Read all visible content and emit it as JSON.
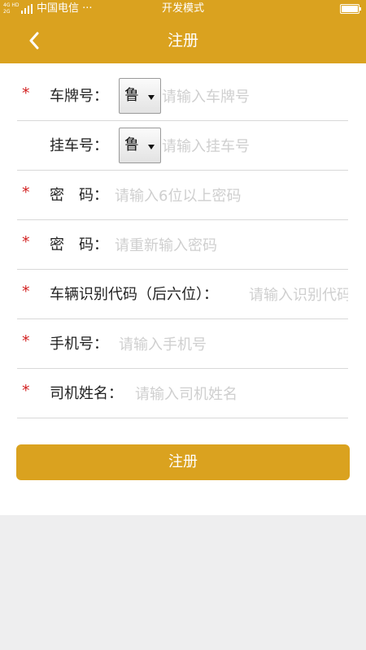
{
  "status_bar": {
    "signal_small_top": "4G HD",
    "signal_small_bottom": "2G",
    "carrier": "中国电信 ···",
    "mode": "开发模式",
    "battery_level": 0.95
  },
  "header": {
    "title": "注册",
    "back_icon": "chevron-left-icon"
  },
  "form": {
    "rows": [
      {
        "required": true,
        "star": "*",
        "label": "车牌号：",
        "select": "鲁",
        "placeholder": "请输入车牌号"
      },
      {
        "required": false,
        "star": "",
        "label": "挂车号：",
        "select": "鲁",
        "placeholder": "请输入挂车号"
      },
      {
        "required": true,
        "star": "*",
        "label": "密　码：",
        "placeholder": "请输入6位以上密码"
      },
      {
        "required": true,
        "star": "*",
        "label": "密　码：",
        "placeholder": "请重新输入密码"
      },
      {
        "required": true,
        "star": "*",
        "label": "车辆识别代码（后六位）：",
        "placeholder": "请输入识别代码"
      },
      {
        "required": true,
        "star": "*",
        "label": "手机号：",
        "placeholder": "请输入手机号"
      },
      {
        "required": true,
        "star": "*",
        "label": "司机姓名：",
        "placeholder": "请输入司机姓名"
      }
    ],
    "submit_label": "注册"
  },
  "colors": {
    "accent": "#DAA21F",
    "required_star": "#d21f1f",
    "page_background": "#eeeeef"
  }
}
